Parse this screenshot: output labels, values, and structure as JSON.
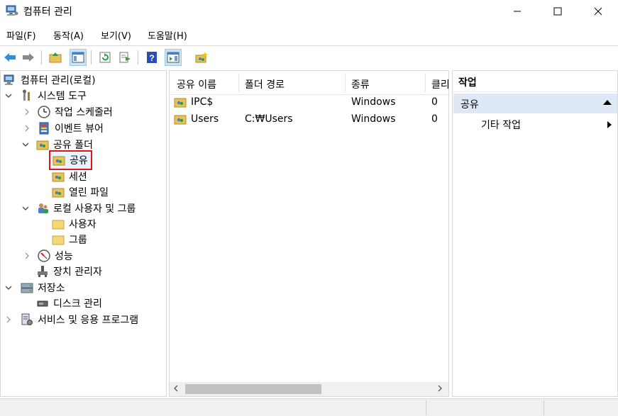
{
  "window": {
    "title": "컴퓨터 관리"
  },
  "menu": [
    "파일(F)",
    "동작(A)",
    "보기(V)",
    "도움말(H)"
  ],
  "tree": {
    "root": "컴퓨터 관리(로컬)",
    "system_tools": "시스템 도구",
    "task_scheduler": "작업 스케줄러",
    "event_viewer": "이벤트 뷰어",
    "shared_folders": "공유 폴더",
    "shares": "공유",
    "sessions": "세션",
    "open_files": "열린 파일",
    "local_users_groups": "로컬 사용자 및 그룹",
    "users": "사용자",
    "groups": "그룹",
    "performance": "성능",
    "device_manager": "장치 관리자",
    "storage": "저장소",
    "disk_management": "디스크 관리",
    "services_apps": "서비스 및 응용 프로그램"
  },
  "list": {
    "columns": [
      "공유 이름",
      "폴더 경로",
      "종류",
      "클리"
    ],
    "rows": [
      {
        "name": "IPC$",
        "path": "",
        "type": "Windows",
        "clients": "0"
      },
      {
        "name": "Users",
        "path": "C:₩Users",
        "type": "Windows",
        "clients": "0"
      }
    ]
  },
  "actions": {
    "title": "작업",
    "section": "공유",
    "more": "기타 작업"
  },
  "colors": {
    "selection_highlight": "#e0141e",
    "action_section_bg": "#dfe9f5",
    "toolbar_active": "#cce4f7"
  }
}
